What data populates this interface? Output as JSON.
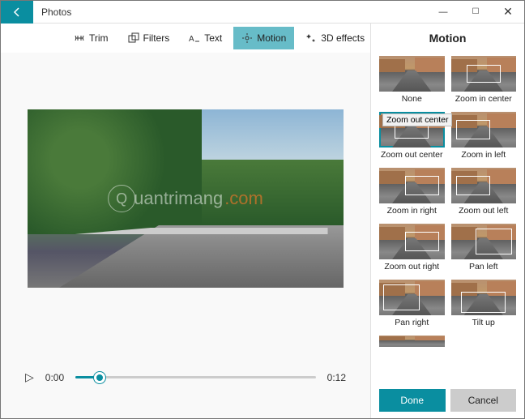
{
  "titlebar": {
    "title": "Photos"
  },
  "toolbar": {
    "trim": "Trim",
    "filters": "Filters",
    "text": "Text",
    "motion": "Motion",
    "effects3d": "3D effects"
  },
  "player": {
    "current": "0:00",
    "duration": "0:12"
  },
  "panel": {
    "title": "Motion",
    "tooltip": "Zoom out center",
    "options": [
      "None",
      "Zoom in center",
      "Zoom out center",
      "Zoom in left",
      "Zoom in right",
      "Zoom out left",
      "Zoom out right",
      "Pan left",
      "Pan right",
      "Tilt up"
    ],
    "done": "Done",
    "cancel": "Cancel"
  },
  "watermark": "uantrimang"
}
